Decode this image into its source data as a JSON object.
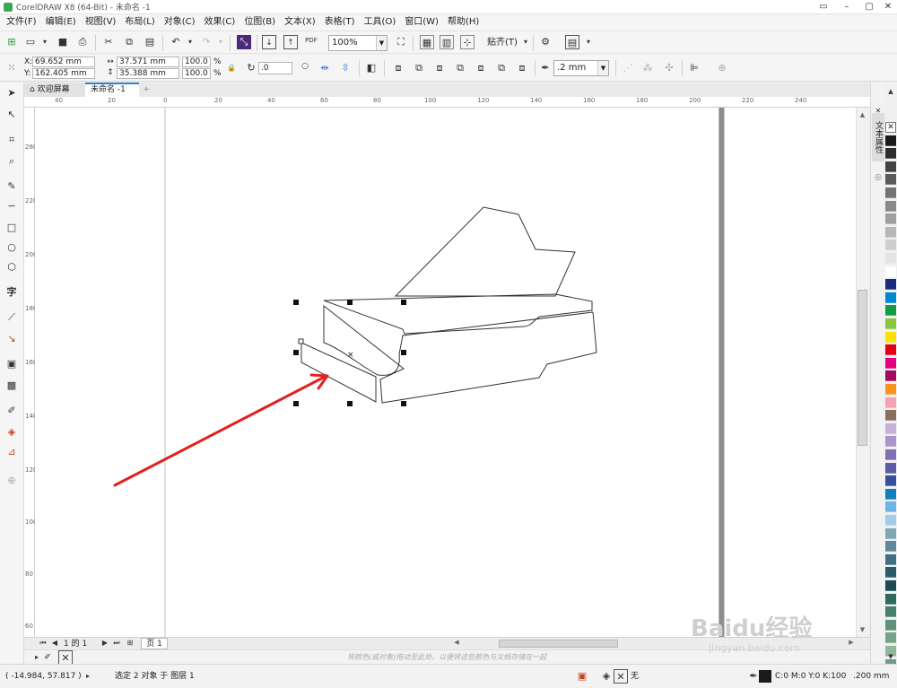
{
  "window": {
    "title": "CorelDRAW X8 (64-Bit) - 未命名 -1"
  },
  "menu": [
    "文件(F)",
    "编辑(E)",
    "视图(V)",
    "布局(L)",
    "对象(C)",
    "效果(C)",
    "位图(B)",
    "文本(X)",
    "表格(T)",
    "工具(O)",
    "窗口(W)",
    "帮助(H)"
  ],
  "toolbar": {
    "zoom": "100%",
    "pdf_label": "PDF",
    "snap_label": "贴齐(T)"
  },
  "property_bar": {
    "x_label": "X:",
    "x": "69.652 mm",
    "y_label": "Y:",
    "y": "162.405 mm",
    "w": "37.571 mm",
    "h": "35.388 mm",
    "scale_w": "100.0",
    "scale_h": "100.0",
    "pct": "%",
    "angle": ".0",
    "outline": ".2 mm"
  },
  "tabs": {
    "welcome": "欢迎屏幕",
    "doc": "未命名 -1",
    "add": "+"
  },
  "ruler_top": [
    "40",
    "20",
    "0",
    "20",
    "40",
    "60",
    "80",
    "100",
    "120",
    "140",
    "160",
    "180",
    "200",
    "220",
    "240"
  ],
  "ruler_left": [
    "280",
    "220",
    "200",
    "180",
    "160",
    "140",
    "120",
    "100",
    "80",
    "60"
  ],
  "pagebar": {
    "page_counter": "1 的 1",
    "page_tab": "页 1"
  },
  "drop_hint": "将颜色(或对象)拖动至此处，以便将这些颜色与文档存储在一起",
  "docker": {
    "label": "文本属性"
  },
  "status": {
    "coords": "( -14.984, 57.817 )",
    "selection": "选定 2 对象 于 图层 1",
    "fill": "无",
    "color_model": "C:0 M:0 Y:0 K:100",
    "outline_width": ".200 mm"
  },
  "watermark": {
    "brand": "Baidu经验",
    "url": "jingyan.baidu.com"
  },
  "colors": {
    "accent": "#2f7fd0",
    "arrow": "#e32020",
    "pen_color": "#1b1b1b"
  },
  "palette": [
    "#ffffff",
    "#1a1a1a",
    "#2e2e2e",
    "#444444",
    "#5b5b5b",
    "#737373",
    "#8a8a8a",
    "#a0a0a0",
    "#b7b7b7",
    "#cecece",
    "#e4e4e4",
    "#ffffff",
    "#1b2a7c",
    "#0089d0",
    "#149b48",
    "#8cc63f",
    "#ffe100",
    "#e30016",
    "#e4007f",
    "#a40b5d",
    "#f7931e",
    "#f4a3b4",
    "#8a6e5e",
    "#c6b1dc",
    "#a995c9",
    "#8170b4",
    "#5b5ca5",
    "#384f9e",
    "#0f7fc1",
    "#6db5e4",
    "#a2cde8",
    "#7ea7b8",
    "#5e8a9c",
    "#436f84",
    "#2a5a6b",
    "#1b4a54",
    "#306a5e",
    "#487e6c",
    "#5f9278",
    "#77a487",
    "#92b89a",
    "#6e9e8b"
  ]
}
